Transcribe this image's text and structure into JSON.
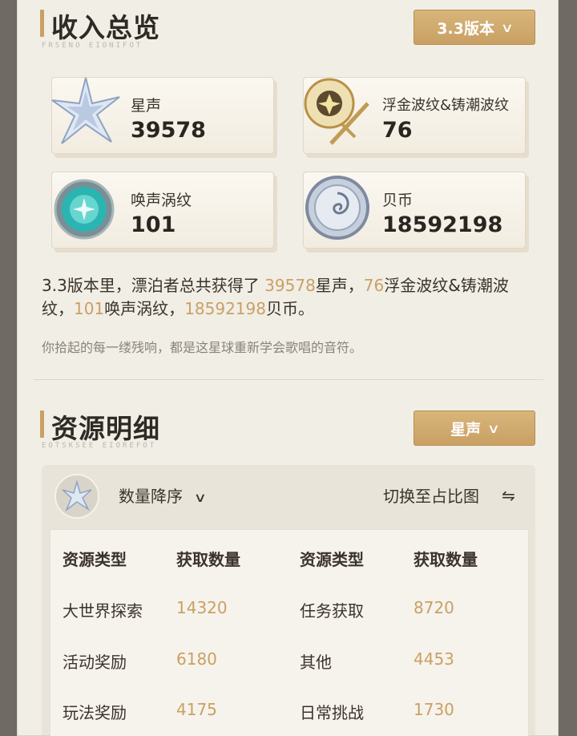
{
  "income": {
    "title": "收入总览",
    "subtitle": "FRSENO EIONIFOT",
    "version_select": "3.3版本",
    "cards": [
      {
        "label": "星声",
        "value": "39578",
        "icon": "star-crystal-icon"
      },
      {
        "label": "浮金波纹&铸潮波纹",
        "value": "76",
        "icon": "golden-orb-sword-icon"
      },
      {
        "label": "唤声涡纹",
        "value": "101",
        "icon": "teal-orb-icon"
      },
      {
        "label": "贝币",
        "value": "18592198",
        "icon": "shell-coin-icon"
      }
    ],
    "summary": {
      "p1": "3.3版本里，漂泊者总共获得了 ",
      "v1": "39578",
      "p2": "星声，",
      "v2": "76",
      "p3": "浮金波纹&铸潮波纹，",
      "v3": "101",
      "p4": "唤声涡纹，",
      "v4": "18592198",
      "p5": "贝币。"
    },
    "quote": "你拾起的每一缕残响，都是这星球重新学会歌唱的音符。"
  },
  "detail": {
    "title": "资源明细",
    "subtitle": "EOTSKSEE EIOREFOT",
    "resource_select": "星声",
    "sort_label": "数量降序",
    "switch_label": "切换至占比图",
    "headers": [
      "资源类型",
      "获取数量",
      "资源类型",
      "获取数量"
    ],
    "rows": [
      [
        {
          "name": "大世界探索",
          "value": "14320"
        },
        {
          "name": "任务获取",
          "value": "8720"
        }
      ],
      [
        {
          "name": "活动奖励",
          "value": "6180"
        },
        {
          "name": "其他",
          "value": "4453"
        }
      ],
      [
        {
          "name": "玩法奖励",
          "value": "4175"
        },
        {
          "name": "日常挑战",
          "value": "1730"
        }
      ]
    ]
  },
  "colors": {
    "accent": "#c9a064",
    "text": "#3a332b",
    "panel": "#f1eee6"
  }
}
